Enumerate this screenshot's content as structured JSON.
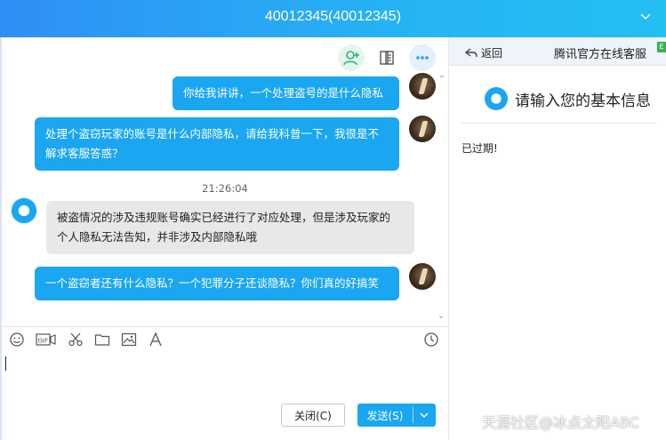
{
  "window": {
    "title": "40012345(40012345)"
  },
  "chat": {
    "messages": [
      {
        "sender": "me",
        "text": "你给我讲讲，一个处理盗号的是什么隐私"
      },
      {
        "sender": "me",
        "line1": "处理个盗窃玩家的账号是什么内部隐私，请给我科普一下，我很是不",
        "line2": "解求客服答惑？"
      },
      {
        "sender": "service",
        "line1": "被盗情况的涉及违规账号确实已经进行了对应处理，但是涉及玩家的",
        "line2": "个人隐私无法告知，并非涉及内部隐私哦"
      },
      {
        "sender": "me",
        "text": "一个盗窃者还有什么隐私？一个犯罪分子还谈隐私？你们真的好搞笑"
      }
    ],
    "timestamp": "21:26:04"
  },
  "input": {
    "close_label": "关闭(C)",
    "send_label": "发送(S)"
  },
  "side": {
    "back_label": "返回",
    "title": "腾讯官方在线客服",
    "info_title": "请输入您的基本信息",
    "expired": "已过期!"
  },
  "watermark": "天涯社区@冰点太阳ABC",
  "colors": {
    "accent": "#1aa6f0",
    "title_bar": "#26b3f4"
  }
}
